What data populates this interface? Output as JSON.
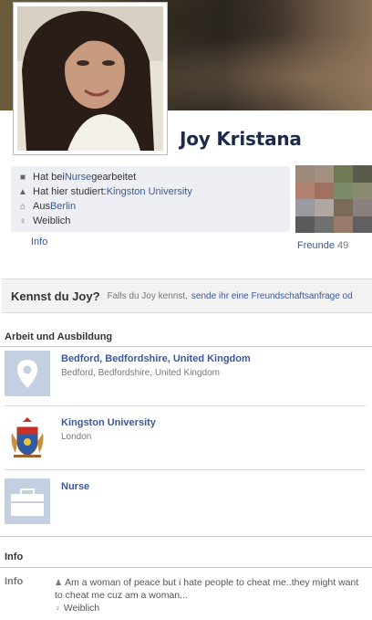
{
  "profile": {
    "name": "Joy Kristana"
  },
  "facts": [
    {
      "icon": "briefcase-icon",
      "prefix": "Hat bei ",
      "link": "Nurse",
      "suffix": " gearbeitet"
    },
    {
      "icon": "graduation-cap-icon",
      "prefix": "Hat hier studiert: ",
      "link": "Kingston University",
      "suffix": ""
    },
    {
      "icon": "home-icon",
      "prefix": "Aus ",
      "link": "Berlin",
      "suffix": ""
    },
    {
      "icon": "female-icon",
      "prefix": "Weiblich",
      "link": "",
      "suffix": ""
    }
  ],
  "tabs": {
    "info": "Info"
  },
  "friends": {
    "label": "Freunde",
    "count": "49",
    "thumb_colors": [
      "#9b8a7a",
      "#a39080",
      "#6f7a55",
      "#5a5a4a",
      "#b08070",
      "#a07060",
      "#7d8a6a",
      "#8a8a70",
      "#9a9aa0",
      "#b0a8a0",
      "#7a6a5a",
      "#8a8080",
      "#5a5a5a",
      "#707070",
      "#9a7a6a",
      "#606060"
    ]
  },
  "kennst": {
    "question": "Kennst du Joy?",
    "hint": "Falls du Joy kennst,",
    "request": "sende ihr eine Freundschaftsanfrage od"
  },
  "work_section": {
    "heading": "Arbeit und Ausbildung",
    "items": [
      {
        "icon": "map-pin-icon",
        "title": "Bedford, Bedfordshire, United Kingdom",
        "sub": "Bedford, Bedfordshire, United Kingdom"
      },
      {
        "icon": "coat-of-arms-icon",
        "title": "Kingston University",
        "sub": "London"
      },
      {
        "icon": "briefcase-icon",
        "title": "Nurse",
        "sub": ""
      }
    ]
  },
  "info_section": {
    "heading": "Info",
    "label": "Info",
    "about": "Am a woman of peace but i hate people to cheat me..they might want to cheat me cuz am a woman...",
    "gender": "Weiblich"
  },
  "colors": {
    "link": "#3b5998",
    "name": "#1d2a4a",
    "facts_bg": "#edeff4",
    "placeholder": "#c5cfe2"
  }
}
